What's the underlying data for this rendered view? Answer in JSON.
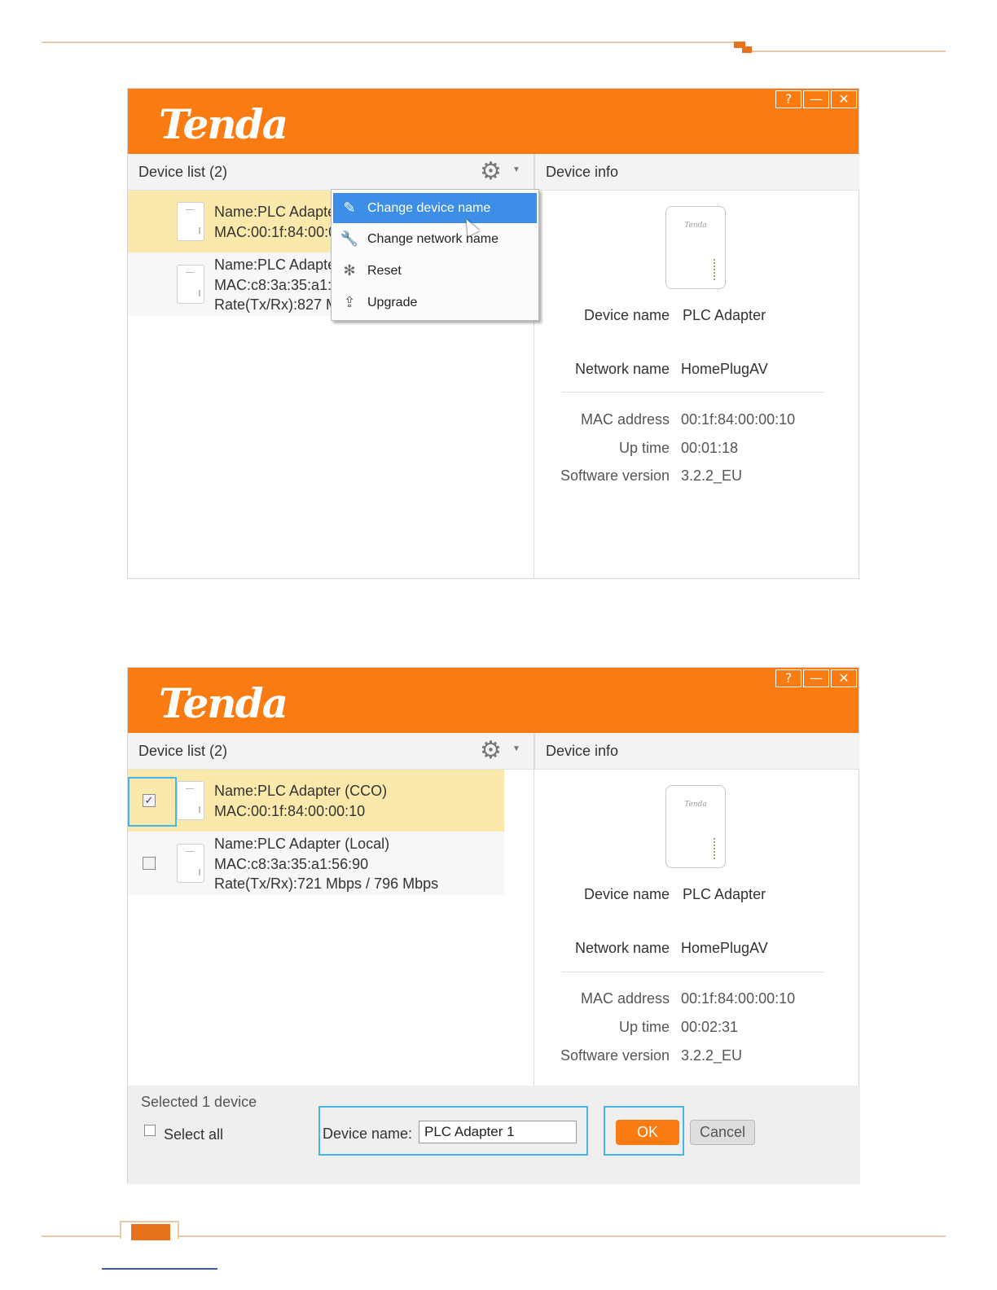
{
  "brand": "Tenda",
  "window_controls": {
    "help": "?",
    "minimize": "—",
    "close": "✕"
  },
  "colors": {
    "accent": "#f97b12",
    "selected_row": "#fbe9ab",
    "menu_highlight": "#3d8ee6",
    "callout": "#45b6e8"
  },
  "screenshot1": {
    "device_list_title": "Device list (2)",
    "device_info_title": "Device info",
    "devices": [
      {
        "line1": "Name:PLC Adapte",
        "line2": "MAC:00:1f:84:00:0"
      },
      {
        "line1": "Name:PLC Adapte",
        "line2": "MAC:c8:3a:35:a1:5",
        "line3": "Rate(Tx/Rx):827 M"
      }
    ],
    "menu": [
      {
        "label": "Change device name",
        "icon": "edit-icon"
      },
      {
        "label": "Change network name",
        "icon": "wrench-icon"
      },
      {
        "label": "Reset",
        "icon": "reset-icon"
      },
      {
        "label": "Upgrade",
        "icon": "upload-icon"
      }
    ],
    "info": {
      "device_name_label": "Device name",
      "device_name": "PLC Adapter",
      "network_name_label": "Network name",
      "network_name": "HomePlugAV",
      "mac_label": "MAC address",
      "mac": "00:1f:84:00:00:10",
      "uptime_label": "Up time",
      "uptime": "00:01:18",
      "software_label": "Software version",
      "software": "3.2.2_EU"
    }
  },
  "screenshot2": {
    "device_list_title": "Device list (2)",
    "device_info_title": "Device info",
    "devices": [
      {
        "line1": "Name:PLC Adapter (CCO)",
        "line2": "MAC:00:1f:84:00:00:10",
        "checked": true
      },
      {
        "line1": "Name:PLC Adapter (Local)",
        "line2": "MAC:c8:3a:35:a1:56:90",
        "line3": "Rate(Tx/Rx):721 Mbps / 796 Mbps",
        "checked": false
      }
    ],
    "info": {
      "device_name_label": "Device name",
      "device_name": "PLC Adapter",
      "network_name_label": "Network name",
      "network_name": "HomePlugAV",
      "mac_label": "MAC address",
      "mac": "00:1f:84:00:00:10",
      "uptime_label": "Up time",
      "uptime": "00:02:31",
      "software_label": "Software version",
      "software": "3.2.2_EU"
    },
    "bottom": {
      "selected_text": "Selected 1 device",
      "select_all": "Select all",
      "device_name_label": "Device name:",
      "device_name_value": "PLC Adapter 1",
      "ok": "OK",
      "cancel": "Cancel"
    }
  }
}
